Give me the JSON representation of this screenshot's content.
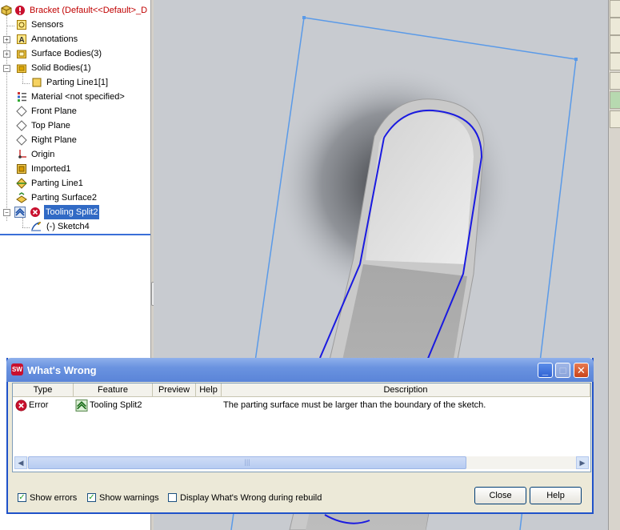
{
  "tree": {
    "root": "Bracket  (Default<<Default>_D",
    "items": [
      {
        "label": "Sensors",
        "icon": "sensor-icon"
      },
      {
        "label": "Annotations",
        "icon": "annotations-icon"
      },
      {
        "label": "Surface Bodies(3)",
        "icon": "folder-icon"
      },
      {
        "label": "Solid Bodies(1)",
        "icon": "folder-icon"
      },
      {
        "label": "Parting Line1[1]",
        "icon": "body-icon"
      },
      {
        "label": "Material <not specified>",
        "icon": "material-icon"
      },
      {
        "label": "Front Plane",
        "icon": "plane-icon"
      },
      {
        "label": "Top Plane",
        "icon": "plane-icon"
      },
      {
        "label": "Right Plane",
        "icon": "plane-icon"
      },
      {
        "label": "Origin",
        "icon": "origin-icon"
      },
      {
        "label": "Imported1",
        "icon": "imported-icon"
      },
      {
        "label": "Parting Line1",
        "icon": "parting-line-icon"
      },
      {
        "label": "Parting Surface2",
        "icon": "parting-surface-icon"
      },
      {
        "label": "Tooling Split2",
        "icon": "tooling-split-icon"
      },
      {
        "label": "(-) Sketch4",
        "icon": "sketch-icon"
      }
    ]
  },
  "dialog": {
    "title": "What's Wrong",
    "columns": [
      "Type",
      "Feature",
      "Preview",
      "Help",
      "Description"
    ],
    "rows": [
      {
        "type": "Error",
        "feature": "Tooling Split2",
        "preview": "",
        "help": "",
        "description": "The parting surface must be larger than the boundary of the sketch."
      }
    ],
    "checkboxes": [
      {
        "label": "Show errors",
        "checked": true
      },
      {
        "label": "Show warnings",
        "checked": true
      },
      {
        "label": "Display What's Wrong during rebuild",
        "checked": false
      }
    ],
    "close_label": "Close",
    "help_label": "Help"
  },
  "colors": {
    "error_red": "#c00000",
    "selection_blue": "#316ac5",
    "xp_title_blue": "#0a246a",
    "sketch_blue": "#1a1ae0",
    "plane_outline": "#5a9ae8"
  }
}
